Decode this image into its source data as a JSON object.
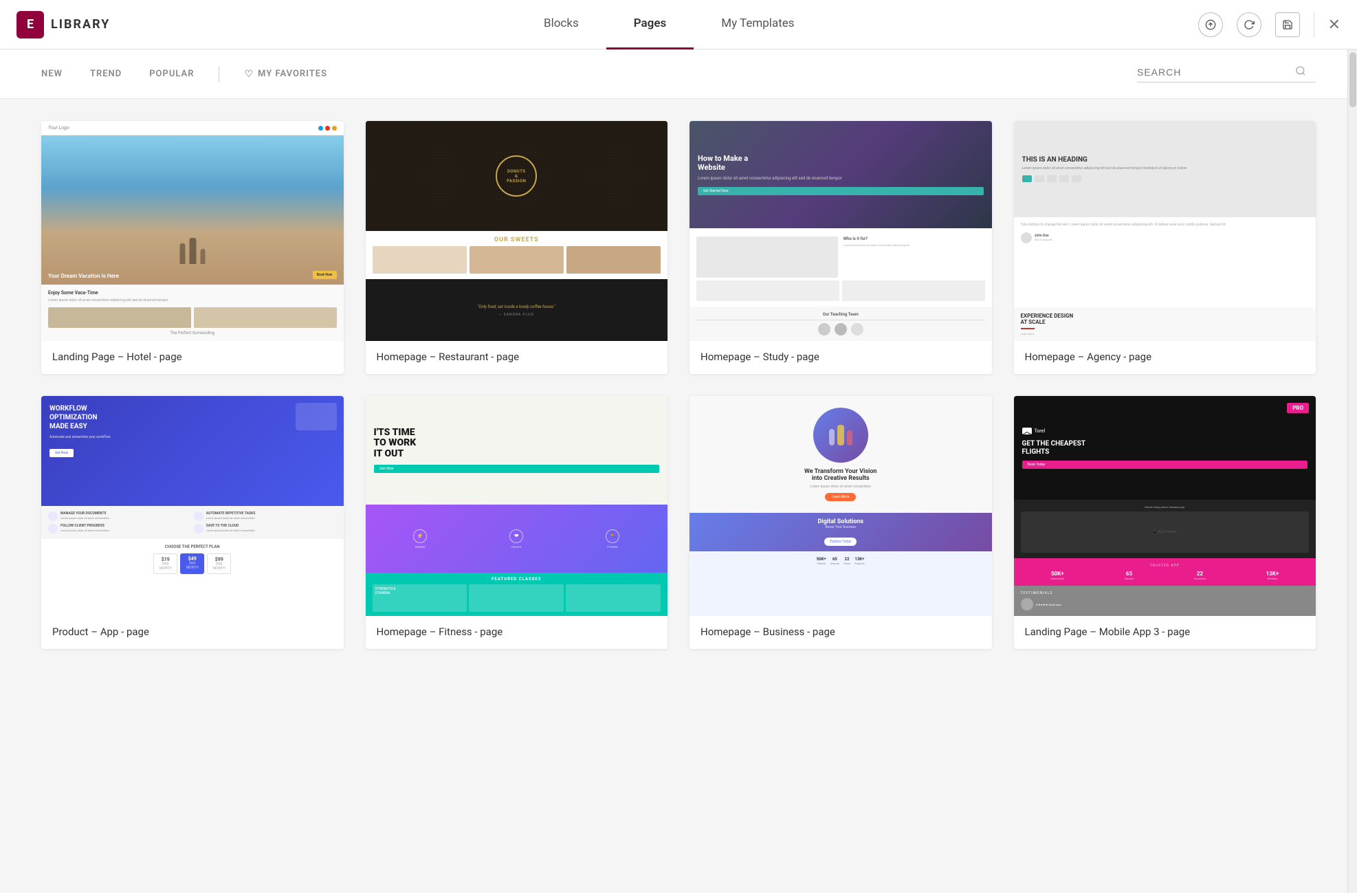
{
  "header": {
    "logo_letter": "E",
    "logo_text": "LIBRARY",
    "tabs": [
      {
        "id": "blocks",
        "label": "Blocks",
        "active": false
      },
      {
        "id": "pages",
        "label": "Pages",
        "active": true
      },
      {
        "id": "my-templates",
        "label": "My Templates",
        "active": false
      }
    ],
    "actions": {
      "upload_title": "Upload",
      "refresh_title": "Refresh",
      "save_title": "Save",
      "close_title": "Close"
    }
  },
  "filter_bar": {
    "tabs": [
      {
        "id": "new",
        "label": "NEW"
      },
      {
        "id": "trend",
        "label": "TREND"
      },
      {
        "id": "popular",
        "label": "POPULAR"
      },
      {
        "id": "favorites",
        "label": "MY FAVORITES",
        "icon": "heart"
      }
    ],
    "search": {
      "placeholder": "SEARCH"
    }
  },
  "cards": [
    {
      "id": "hotel",
      "title": "Landing Page – Hotel - page",
      "preview_type": "hotel"
    },
    {
      "id": "restaurant",
      "title": "Homepage – Restaurant - page",
      "preview_type": "restaurant"
    },
    {
      "id": "study",
      "title": "Homepage – Study - page",
      "preview_type": "study"
    },
    {
      "id": "agency",
      "title": "Homepage – Agency - page",
      "preview_type": "agency"
    },
    {
      "id": "app",
      "title": "Product – App - page",
      "preview_type": "app"
    },
    {
      "id": "fitness",
      "title": "Homepage – Fitness - page",
      "preview_type": "fitness"
    },
    {
      "id": "business",
      "title": "Homepage – Business - page",
      "preview_type": "business"
    },
    {
      "id": "mobile",
      "title": "Landing Page – Mobile App 3 - page",
      "preview_type": "mobile",
      "pro": true
    }
  ]
}
